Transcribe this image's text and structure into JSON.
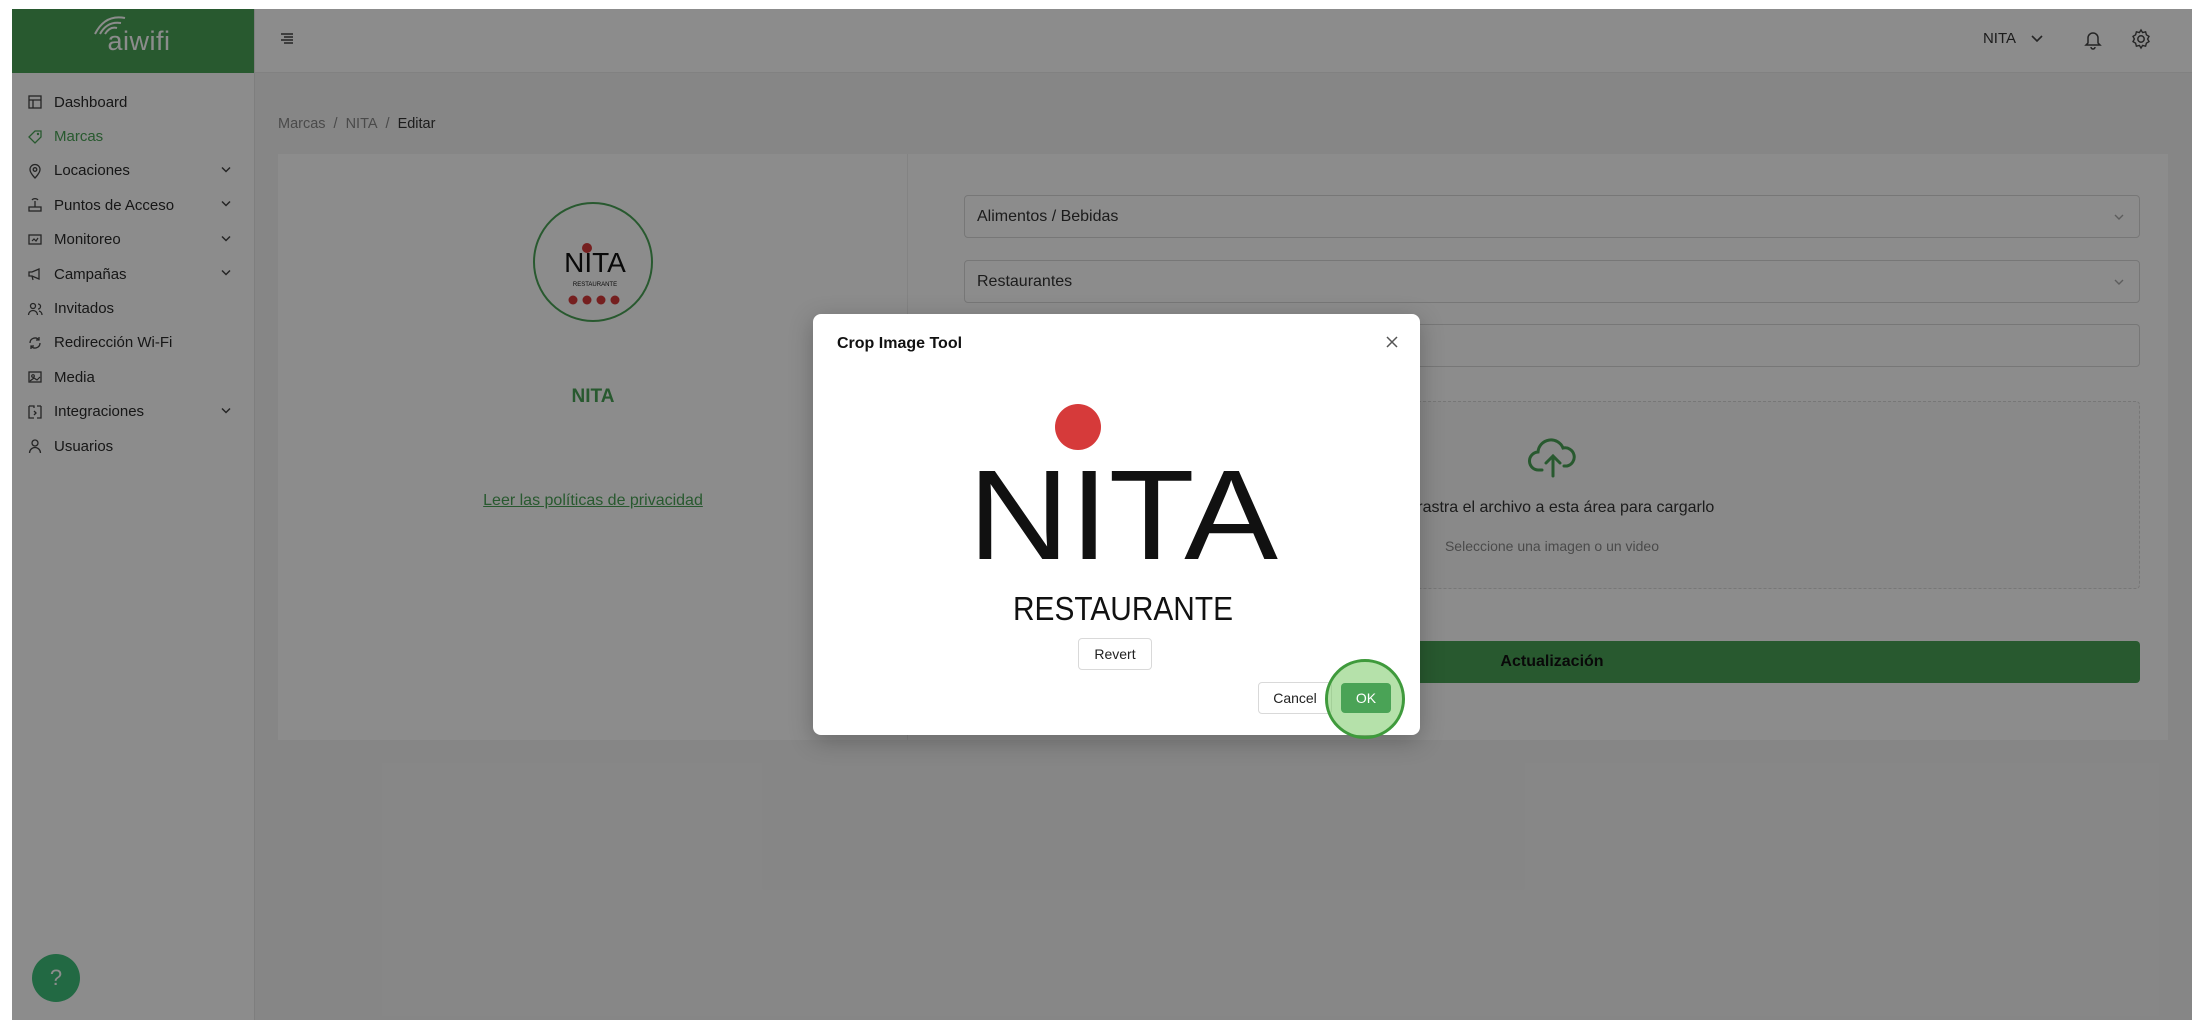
{
  "app": {
    "logo_text": "aiwifi"
  },
  "colors": {
    "accent": "#4aa356",
    "help": "#3fbf7a",
    "logo_red": "#d63a3a"
  },
  "sidebar": {
    "items": [
      {
        "label": "Dashboard",
        "icon": "dashboard-icon",
        "expandable": false
      },
      {
        "label": "Marcas",
        "icon": "tag-icon",
        "expandable": false,
        "active": true
      },
      {
        "label": "Locaciones",
        "icon": "map-pin-icon",
        "expandable": true
      },
      {
        "label": "Puntos de Acceso",
        "icon": "router-icon",
        "expandable": true
      },
      {
        "label": "Monitoreo",
        "icon": "monitor-icon",
        "expandable": true
      },
      {
        "label": "Campañas",
        "icon": "megaphone-icon",
        "expandable": true
      },
      {
        "label": "Invitados",
        "icon": "users-icon",
        "expandable": false
      },
      {
        "label": "Redirección Wi-Fi",
        "icon": "redirect-icon",
        "expandable": false
      },
      {
        "label": "Media",
        "icon": "media-icon",
        "expandable": false
      },
      {
        "label": "Integraciones",
        "icon": "integration-icon",
        "expandable": true
      },
      {
        "label": "Usuarios",
        "icon": "user-icon",
        "expandable": false
      }
    ]
  },
  "topbar": {
    "user": "NITA"
  },
  "breadcrumb": {
    "items": [
      "Marcas",
      "NITA"
    ],
    "current": "Editar",
    "separator": "/"
  },
  "brand": {
    "name": "NITA",
    "logo_word": "NITA",
    "logo_sub": "RESTAURANTE",
    "privacy_link": "Leer las políticas de privacidad"
  },
  "form": {
    "category": "Alimentos / Bebidas",
    "subcategory": "Restaurantes",
    "third_field": "",
    "upload_text": "o arrastra el archivo a esta área para cargarlo",
    "upload_hint": "Seleccione una imagen o un video",
    "submit_label": "Actualización"
  },
  "help": {
    "label": "?"
  },
  "modal": {
    "title": "Crop Image Tool",
    "image_word": "NITA",
    "image_sub": "RESTAURANTE",
    "revert_label": "Revert",
    "cancel_label": "Cancel",
    "ok_label": "OK"
  }
}
